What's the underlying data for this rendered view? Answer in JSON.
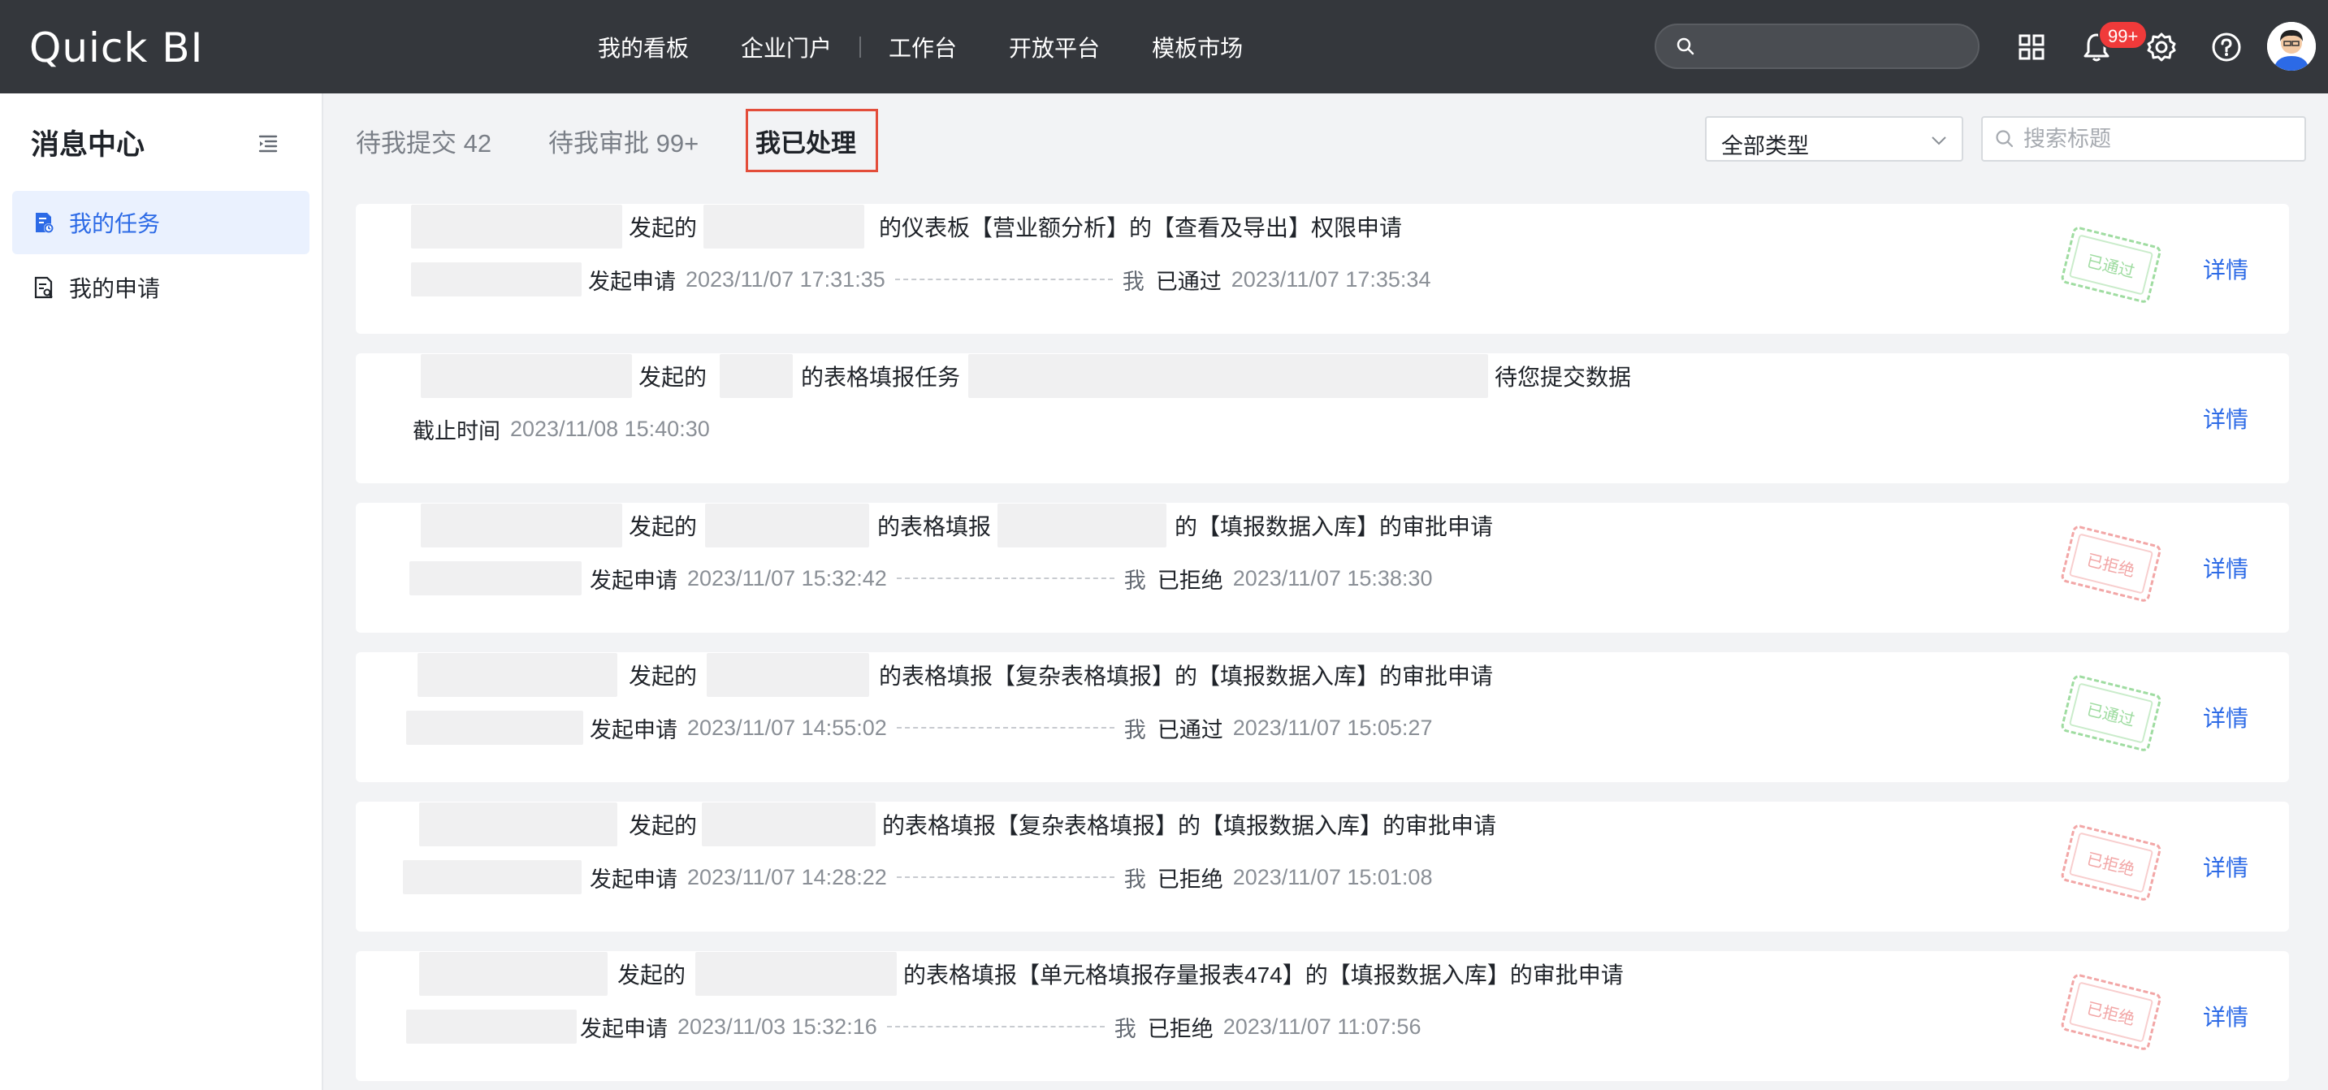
{
  "header": {
    "logo": "Quick BI",
    "nav": [
      "我的看板",
      "企业门户",
      "工作台",
      "开放平台",
      "模板市场"
    ],
    "search_placeholder": "",
    "notification_badge": "99+"
  },
  "sidebar": {
    "title": "消息中心",
    "items": [
      {
        "label": "我的任务",
        "active": true
      },
      {
        "label": "我的申请",
        "active": false
      }
    ]
  },
  "tabs": [
    {
      "label": "待我提交 42",
      "active": false
    },
    {
      "label": "待我审批 99+",
      "active": false
    },
    {
      "label": "我已处理",
      "active": true
    }
  ],
  "filters": {
    "type_select": "全部类型",
    "search_placeholder": "搜索标题"
  },
  "colors": {
    "topbar": "#34373c",
    "accent": "#2c6ae6",
    "approved": "#9fdca1",
    "rejected": "#f2a6a6",
    "tab_highlight": "#e34d3a"
  },
  "tasks": [
    {
      "line1": [
        "发起的",
        "的仪表板【营业额分析】的【查看及导出】权限申请"
      ],
      "line2_action": "发起申请",
      "line2_time": "2023/11/07 17:31:35",
      "me": "我",
      "result": "已通过",
      "result_time": "2023/11/07 17:35:34",
      "stamp": "已通过",
      "detail": "详情"
    },
    {
      "line1": [
        "发起的",
        "的表格填报任务",
        "待您提交数据"
      ],
      "line2_action": "截止时间",
      "line2_time": "2023/11/08 15:40:30",
      "detail": "详情"
    },
    {
      "line1": [
        "发起的",
        "的表格填报",
        "的【填报数据入库】的审批申请"
      ],
      "line2_action": "发起申请",
      "line2_time": "2023/11/07 15:32:42",
      "me": "我",
      "result": "已拒绝",
      "result_time": "2023/11/07 15:38:30",
      "stamp": "已拒绝",
      "detail": "详情"
    },
    {
      "line1": [
        "发起的",
        "的表格填报【复杂表格填报】的【填报数据入库】的审批申请"
      ],
      "line2_action": "发起申请",
      "line2_time": "2023/11/07 14:55:02",
      "me": "我",
      "result": "已通过",
      "result_time": "2023/11/07 15:05:27",
      "stamp": "已通过",
      "detail": "详情"
    },
    {
      "line1": [
        "发起的",
        "的表格填报【复杂表格填报】的【填报数据入库】的审批申请"
      ],
      "line2_action": "发起申请",
      "line2_time": "2023/11/07 14:28:22",
      "me": "我",
      "result": "已拒绝",
      "result_time": "2023/11/07 15:01:08",
      "stamp": "已拒绝",
      "detail": "详情"
    },
    {
      "line1": [
        "发起的",
        "的表格填报【单元格填报存量报表474】的【填报数据入库】的审批申请"
      ],
      "line2_action": "发起申请",
      "line2_time": "2023/11/03 15:32:16",
      "me": "我",
      "result": "已拒绝",
      "result_time": "2023/11/07 11:07:56",
      "stamp": "已拒绝",
      "detail": "详情"
    }
  ]
}
